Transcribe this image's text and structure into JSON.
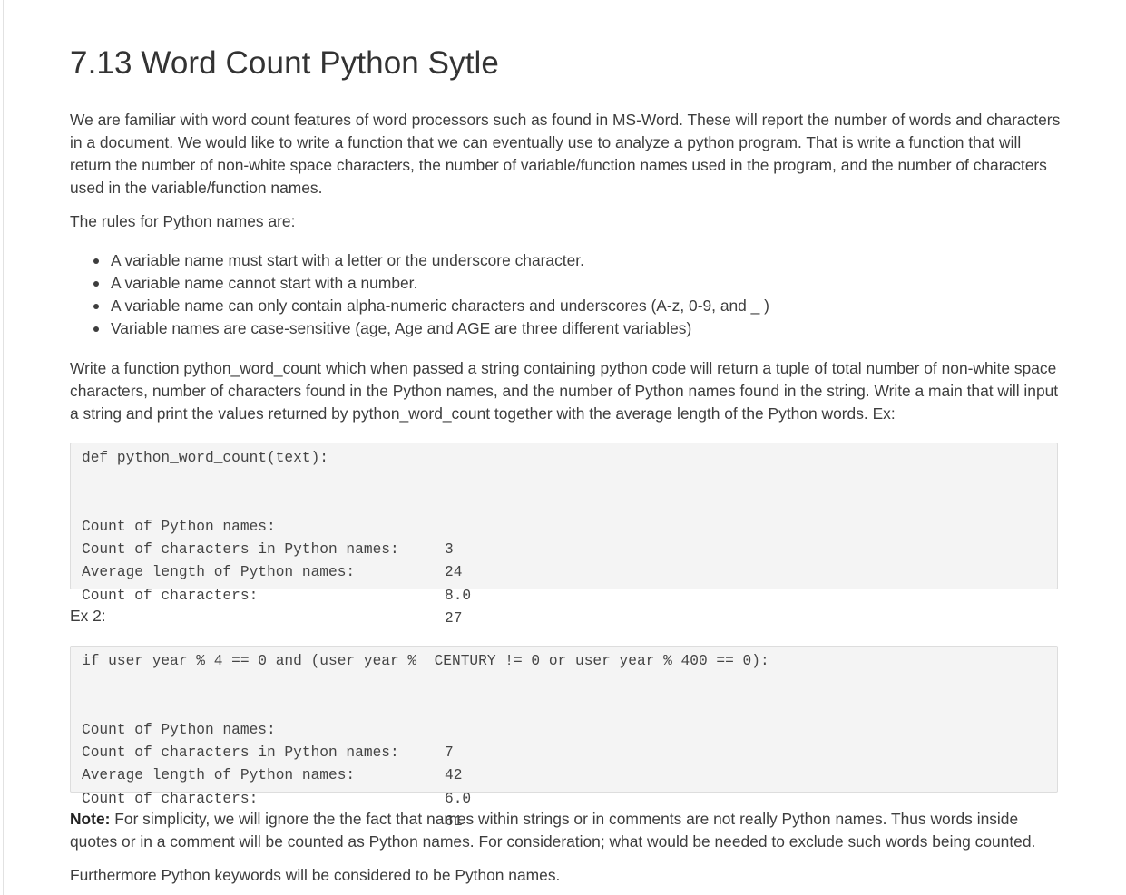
{
  "title": "7.13 Word Count Python Sytle",
  "intro": "We are familiar with word count features of word processors such as found in MS-Word. These will report the number of words and characters in a document. We would like to write a function that we can eventually use to analyze a python program. That is write a function that will return the number of non-white space characters, the number of variable/function names used in the program, and the number of characters used in the variable/function names.",
  "rules_heading": "The rules for Python names are:",
  "rules": [
    "A variable name must start with a letter or the underscore character.",
    "A variable name cannot start with a number.",
    "A variable name can only contain alpha-numeric characters and underscores (A-z, 0-9, and _ )",
    "Variable names are case-sensitive (age, Age and AGE are three different variables)"
  ],
  "task": "Write a function python_word_count which when passed a string containing python code will return a tuple of total number of non-white space characters, number of characters found in the Python names, and the number of Python names found in the string. Write a main that will input a string and print the values returned by python_word_count together with the average length of the Python words. Ex:",
  "example1": {
    "code": "def python_word_count(text):",
    "rows": [
      {
        "label": "Count of Python names:",
        "value": "3"
      },
      {
        "label": "Count of characters in Python names:",
        "value": "24"
      },
      {
        "label": "Average length of Python names:",
        "value": "8.0"
      },
      {
        "label": "Count of characters:",
        "value": "27"
      }
    ]
  },
  "ex2_label": "Ex 2:",
  "example2": {
    "code": "if user_year % 4 == 0 and (user_year % _CENTURY != 0 or user_year % 400 == 0):",
    "rows": [
      {
        "label": "Count of Python names:",
        "value": "7"
      },
      {
        "label": "Count of characters in Python names:",
        "value": "42"
      },
      {
        "label": "Average length of Python names:",
        "value": "6.0"
      },
      {
        "label": "Count of characters:",
        "value": "61"
      }
    ]
  },
  "note": {
    "label": "Note:",
    "text": " For simplicity, we will ignore the the fact that names within strings or in comments are not really Python names. Thus words inside quotes or in a comment will be counted as Python names. For consideration; what would be needed to exclude such words being counted."
  },
  "closing": "Furthermore Python keywords will be considered to be Python names."
}
